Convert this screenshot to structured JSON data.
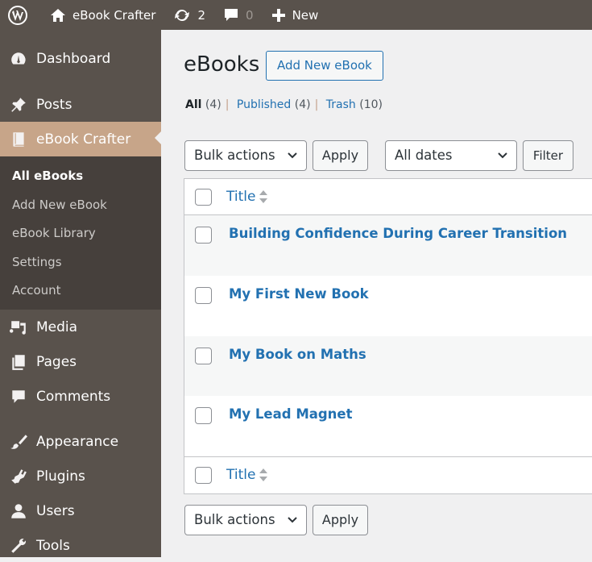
{
  "adminbar": {
    "site_name": "eBook Crafter",
    "updates_count": "2",
    "comments_count": "0",
    "new_label": "New"
  },
  "sidebar": {
    "items": [
      {
        "label": "Dashboard",
        "icon": "dashboard-icon"
      },
      {
        "label": "Posts",
        "icon": "pin-icon"
      },
      {
        "label": "eBook Crafter",
        "icon": "book-icon",
        "active": true
      },
      {
        "label": "Media",
        "icon": "media-icon"
      },
      {
        "label": "Pages",
        "icon": "pages-icon"
      },
      {
        "label": "Comments",
        "icon": "comment-icon"
      },
      {
        "label": "Appearance",
        "icon": "brush-icon"
      },
      {
        "label": "Plugins",
        "icon": "plugin-icon"
      },
      {
        "label": "Users",
        "icon": "user-icon"
      },
      {
        "label": "Tools",
        "icon": "wrench-icon"
      }
    ],
    "submenu": [
      {
        "label": "All eBooks",
        "current": true
      },
      {
        "label": "Add New eBook"
      },
      {
        "label": "eBook Library"
      },
      {
        "label": "Settings"
      },
      {
        "label": "Account"
      }
    ]
  },
  "main": {
    "title": "eBooks",
    "add_new_label": "Add New eBook",
    "views": [
      {
        "label": "All",
        "count": "(4)"
      },
      {
        "label": "Published",
        "count": "(4)"
      },
      {
        "label": "Trash",
        "count": "(10)"
      }
    ],
    "bulk_actions": "Bulk actions",
    "apply_label": "Apply",
    "dates_filter": "All dates",
    "filter_label": "Filter",
    "column_title": "Title",
    "rows": [
      {
        "title": "Building Confidence During Career Transition"
      },
      {
        "title": "My First New Book"
      },
      {
        "title": "My Book on Maths"
      },
      {
        "title": "My Lead Magnet"
      }
    ]
  },
  "colors": {
    "adminbar": "#59524c",
    "active_menu": "#c7a589",
    "submenu": "#46403c",
    "link": "#2271b1"
  }
}
